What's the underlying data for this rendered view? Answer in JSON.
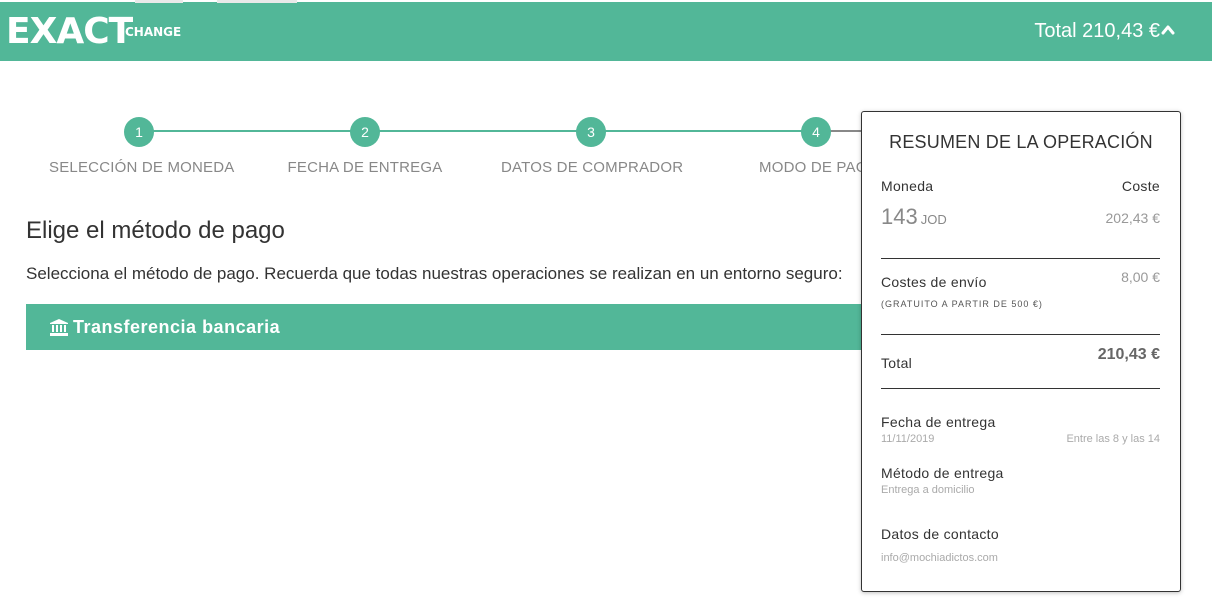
{
  "header": {
    "logo_main": "EXACT",
    "logo_sub": "CHANGE",
    "total_label": "Total 210,43 €",
    "bg_color": "#52b798"
  },
  "stepper": {
    "steps": [
      {
        "number": "1",
        "label": "SELECCIÓN DE MONEDA"
      },
      {
        "number": "2",
        "label": "FECHA DE ENTREGA"
      },
      {
        "number": "3",
        "label": "DATOS DE COMPRADOR"
      },
      {
        "number": "4",
        "label": "MODO DE PAG"
      }
    ],
    "accent_color": "#52b798"
  },
  "main": {
    "title": "Elige el método de pago",
    "description": "Selecciona el método de pago. Recuerda que todas nuestras operaciones se realizan en un entorno seguro:",
    "payment_option": {
      "label": "Transferencia bancaria",
      "icon": "bank-icon"
    }
  },
  "summary": {
    "title": "RESUMEN DE LA OPERACIÓN",
    "currency_label": "Moneda",
    "cost_label": "Coste",
    "amount": "143",
    "currency_code": "JOD",
    "cost_value": "202,43 €",
    "shipping_label": "Costes de envío",
    "shipping_value": "8,00 €",
    "shipping_note": "(GRATUITO A PARTIR DE 500 €)",
    "total_label": "Total",
    "total_value": "210,43 €",
    "delivery_date_label": "Fecha de entrega",
    "delivery_date_value": "11/11/2019",
    "delivery_window": "Entre las 8 y las 14",
    "delivery_method_label": "Método de entrega",
    "delivery_method_value": "Entrega a domicilio",
    "contact_label": "Datos de contacto",
    "contact_value": "info@mochiadictos.com"
  }
}
